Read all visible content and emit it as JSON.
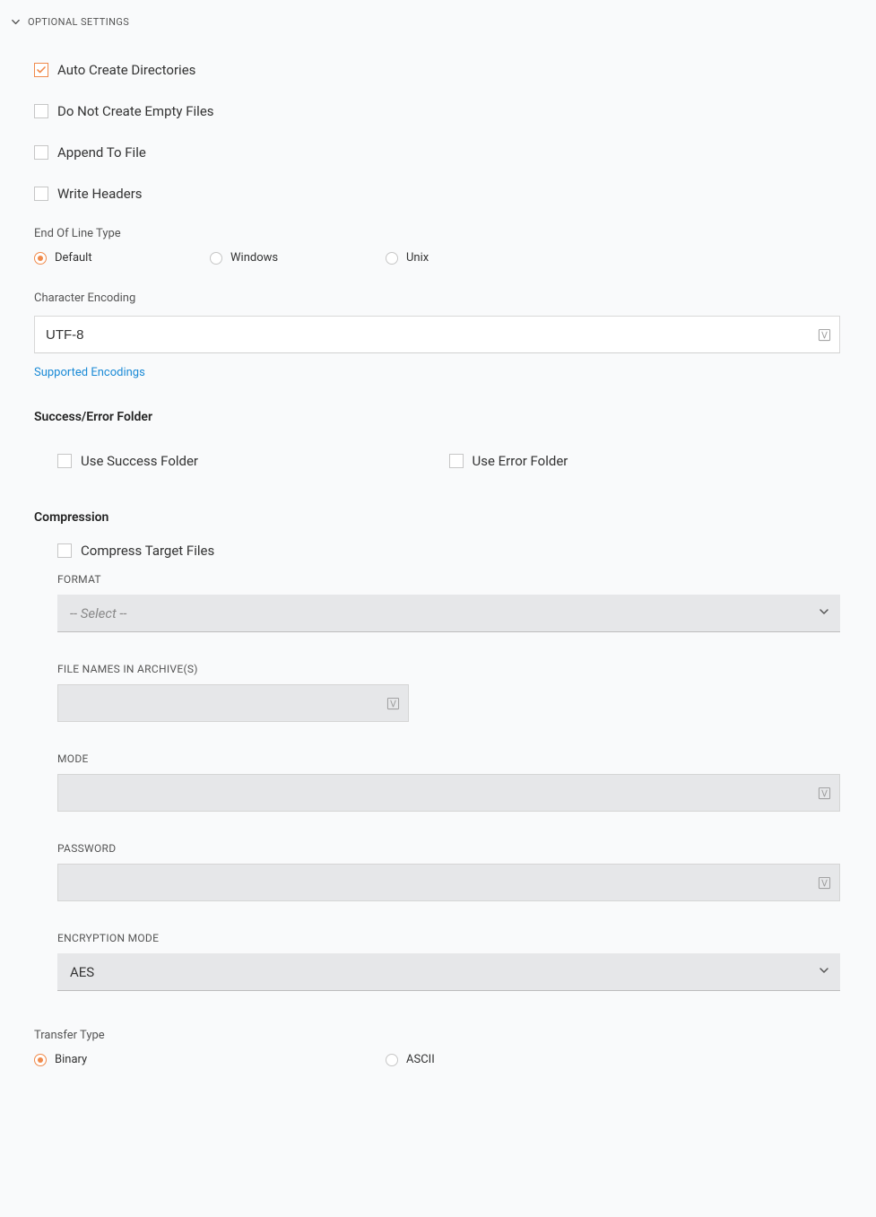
{
  "section": {
    "title": "OPTIONAL SETTINGS"
  },
  "checkboxes": {
    "autoCreateDirs": {
      "label": "Auto Create Directories",
      "checked": true
    },
    "doNotCreateEmpty": {
      "label": "Do Not Create Empty Files",
      "checked": false
    },
    "appendToFile": {
      "label": "Append To File",
      "checked": false
    },
    "writeHeaders": {
      "label": "Write Headers",
      "checked": false
    }
  },
  "eol": {
    "label": "End Of Line Type",
    "options": {
      "default": "Default",
      "windows": "Windows",
      "unix": "Unix"
    },
    "selected": "default"
  },
  "encoding": {
    "label": "Character Encoding",
    "value": "UTF-8",
    "supportedLink": "Supported Encodings"
  },
  "successError": {
    "heading": "Success/Error Folder",
    "useSuccess": {
      "label": "Use Success Folder",
      "checked": false
    },
    "useError": {
      "label": "Use Error Folder",
      "checked": false
    }
  },
  "compression": {
    "heading": "Compression",
    "compressTarget": {
      "label": "Compress Target Files",
      "checked": false
    },
    "formatLabel": "FORMAT",
    "formatPlaceholder": "-- Select --",
    "fileNamesLabel": "FILE NAMES IN ARCHIVE(S)",
    "fileNamesValue": "",
    "modeLabel": "MODE",
    "modeValue": "",
    "passwordLabel": "PASSWORD",
    "passwordValue": "",
    "encryptionModeLabel": "ENCRYPTION MODE",
    "encryptionModeValue": "AES"
  },
  "transfer": {
    "label": "Transfer Type",
    "options": {
      "binary": "Binary",
      "ascii": "ASCII"
    },
    "selected": "binary"
  }
}
